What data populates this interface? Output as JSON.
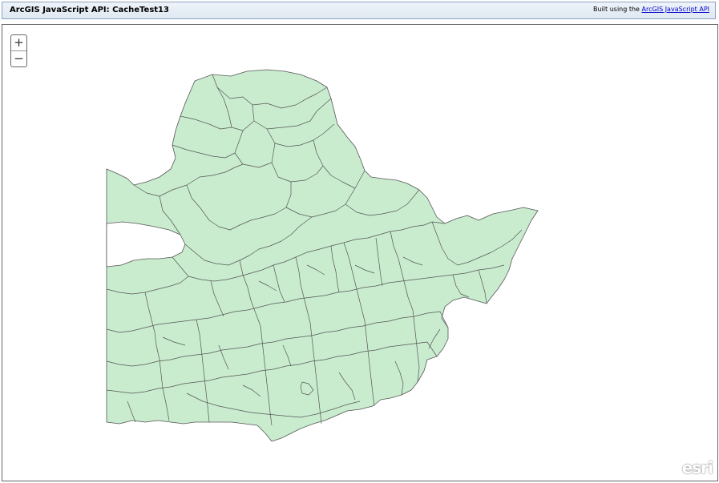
{
  "header": {
    "title": "ArcGIS JavaScript API: CacheTest13",
    "credit_prefix": "Built using the",
    "credit_link": "ArcGIS JavaScript API"
  },
  "map": {
    "zoom_in": "+",
    "zoom_out": "−",
    "logo": "esri",
    "fill_color": "#c9eccf",
    "stroke_color": "#555555"
  }
}
